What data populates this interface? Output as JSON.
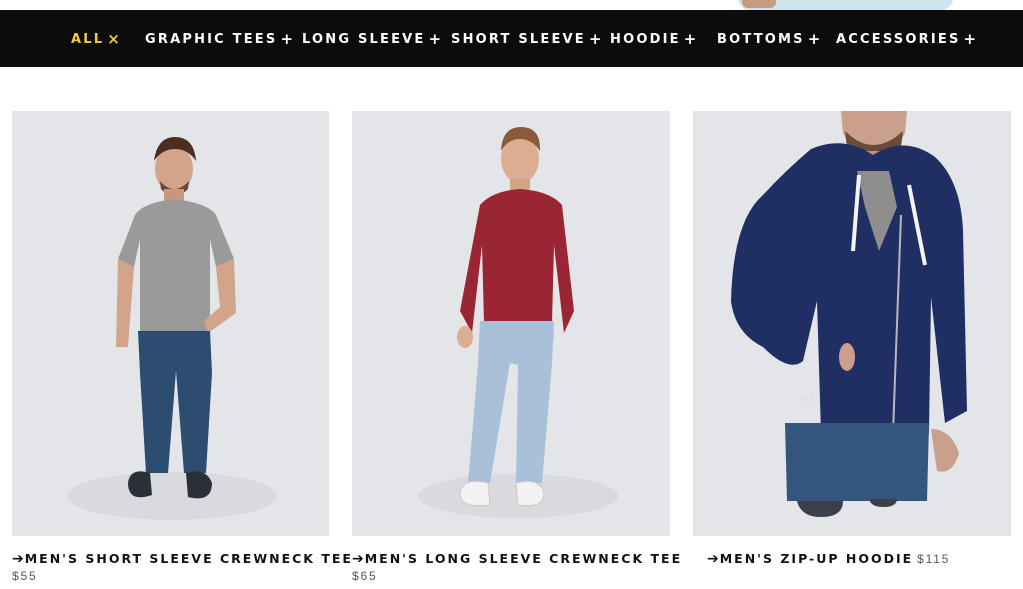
{
  "filters": [
    {
      "label": "ALL",
      "mark": "×",
      "active": true
    },
    {
      "label": "GRAPHIC TEES",
      "mark": "+"
    },
    {
      "label": "LONG SLEEVE",
      "mark": "+"
    },
    {
      "label": "SHORT SLEEVE",
      "mark": "+"
    },
    {
      "label": "HOODIE",
      "mark": "+"
    },
    {
      "label": "BOTTOMS",
      "mark": "+"
    },
    {
      "label": "ACCESSORIES",
      "mark": "+"
    }
  ],
  "products": [
    {
      "arrow": "➔",
      "title": "MEN'S SHORT SLEEVE CREWNECK TEE",
      "price": "$55",
      "image": "man in grey short sleeve crewneck tee and dark jeans",
      "garment_color": "#9a9a9a"
    },
    {
      "arrow": "➔",
      "title": "MEN'S LONG SLEEVE CREWNECK TEE",
      "price": "$65",
      "image": "man in maroon long sleeve crewneck tee and light jeans",
      "garment_color": "#9b2633"
    },
    {
      "arrow": "➔",
      "title": "MEN'S ZIP-UP HOODIE",
      "price": "$115",
      "image": "man in navy zip-up hoodie over grey tee",
      "garment_color": "#1f2f63"
    }
  ],
  "colors": {
    "bar_bg": "#0c0c0c",
    "active_filter": "#f2cd3a",
    "photo_bg": "#e4e5e8"
  }
}
